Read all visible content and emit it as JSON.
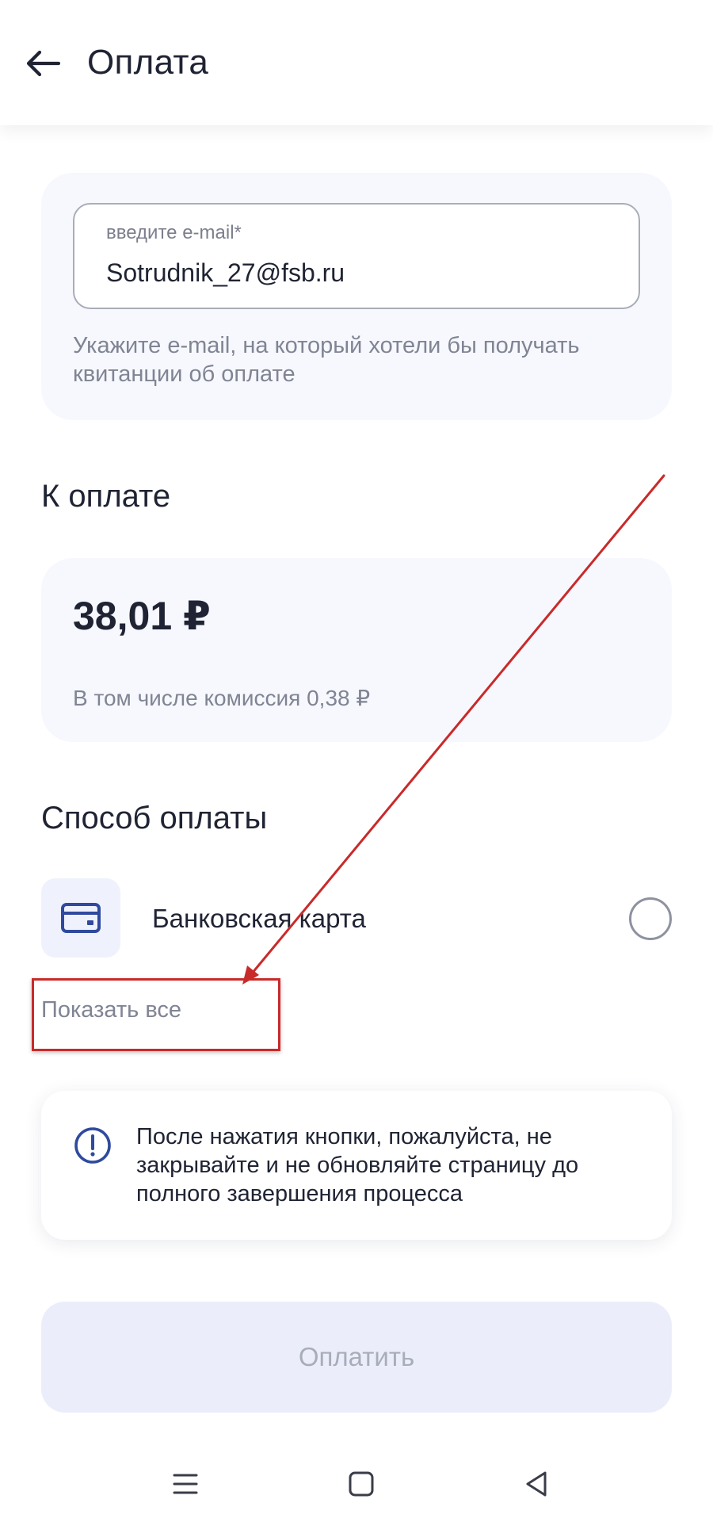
{
  "header": {
    "title": "Оплата",
    "back_icon": "arrow-left-icon"
  },
  "email_section": {
    "label": "введите e-mail*",
    "value": "Sotrudnik_27@fsb.ru",
    "hint": "Укажите e-mail, на который хотели бы получать квитанции об оплате"
  },
  "amount_section": {
    "title": "К оплате",
    "amount": "38,01 ₽",
    "commission": "В том числе комиссия 0,38 ₽"
  },
  "payment_method_section": {
    "title": "Способ оплаты",
    "methods": [
      {
        "label": "Банковская карта",
        "icon": "credit-card-icon",
        "selected": false
      }
    ],
    "show_all": "Показать все"
  },
  "notice": {
    "icon": "exclamation-circle-icon",
    "text": "После нажатия кнопки, пожалуйста, не закрывайте и не обновляйте страницу до полного завершения процесса"
  },
  "pay_button": {
    "label": "Оплатить",
    "enabled": false
  },
  "system_nav": {
    "buttons": [
      "menu-icon",
      "home-square-icon",
      "back-triangle-icon"
    ]
  },
  "colors": {
    "text_primary": "#1f2333",
    "text_secondary": "#808493",
    "card_background": "#f6f8fe",
    "accent_icon": "#2f4a9e",
    "disabled_button": "#ebeefa",
    "annotation_red": "#c92a2a"
  }
}
